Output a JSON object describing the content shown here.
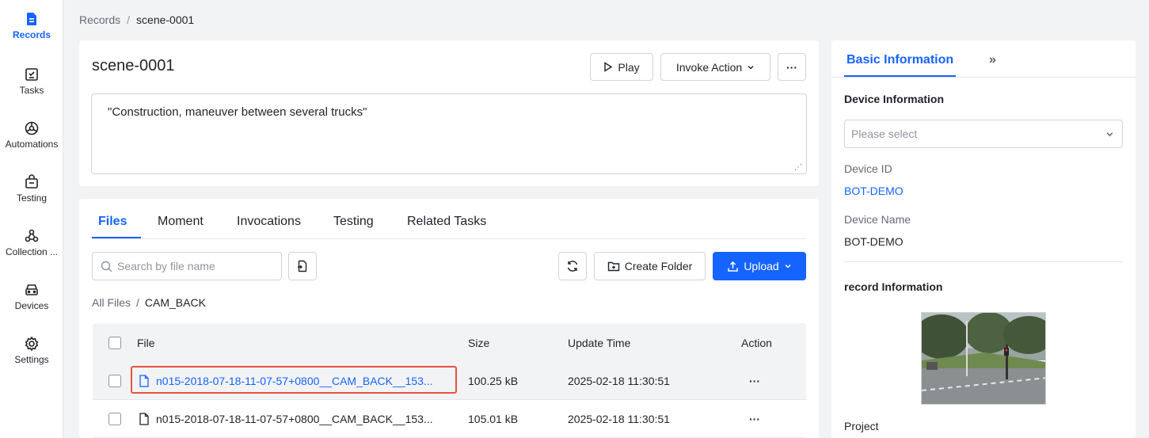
{
  "sidebar": {
    "items": [
      {
        "label": "Records",
        "icon": "records-icon",
        "active": true
      },
      {
        "label": "Tasks",
        "icon": "tasks-icon"
      },
      {
        "label": "Automations",
        "icon": "automations-icon"
      },
      {
        "label": "Testing",
        "icon": "testing-icon"
      },
      {
        "label": "Collection ...",
        "icon": "collection-icon"
      },
      {
        "label": "Devices",
        "icon": "devices-icon"
      },
      {
        "label": "Settings",
        "icon": "settings-icon"
      }
    ]
  },
  "breadcrumb": {
    "root": "Records",
    "separator": "/",
    "current": "scene-0001"
  },
  "header": {
    "title": "scene-0001",
    "play_label": "Play",
    "invoke_label": "Invoke Action",
    "more_label": "···",
    "description": "\"Construction, maneuver between several trucks\""
  },
  "tabs": [
    "Files",
    "Moment",
    "Invocations",
    "Testing",
    "Related Tasks"
  ],
  "files": {
    "search_placeholder": "Search by file name",
    "refresh_icon": "refresh-icon",
    "create_folder_label": "Create Folder",
    "upload_label": "Upload",
    "crumb_root": "All Files",
    "crumb_separator": "/",
    "crumb_current": "CAM_BACK",
    "columns": {
      "file": "File",
      "size": "Size",
      "update_time": "Update Time",
      "action": "Action"
    },
    "rows": [
      {
        "name": "n015-2018-07-18-11-07-57+0800__CAM_BACK__153...",
        "size": "100.25 kB",
        "updated": "2025-02-18 11:30:51",
        "action": "···",
        "highlighted": true
      },
      {
        "name": "n015-2018-07-18-11-07-57+0800__CAM_BACK__153...",
        "size": "105.01 kB",
        "updated": "2025-02-18 11:30:51",
        "action": "···",
        "highlighted": false
      }
    ]
  },
  "panel": {
    "tab": "Basic Information",
    "collapse": "»",
    "device_section": "Device Information",
    "device_placeholder": "Please select",
    "device_id_label": "Device ID",
    "device_id": "BOT-DEMO",
    "device_name_label": "Device Name",
    "device_name": "BOT-DEMO",
    "record_section": "record Information",
    "project_label": "Project"
  },
  "colors": {
    "accent": "#1664ff",
    "highlight": "#e5533d"
  }
}
